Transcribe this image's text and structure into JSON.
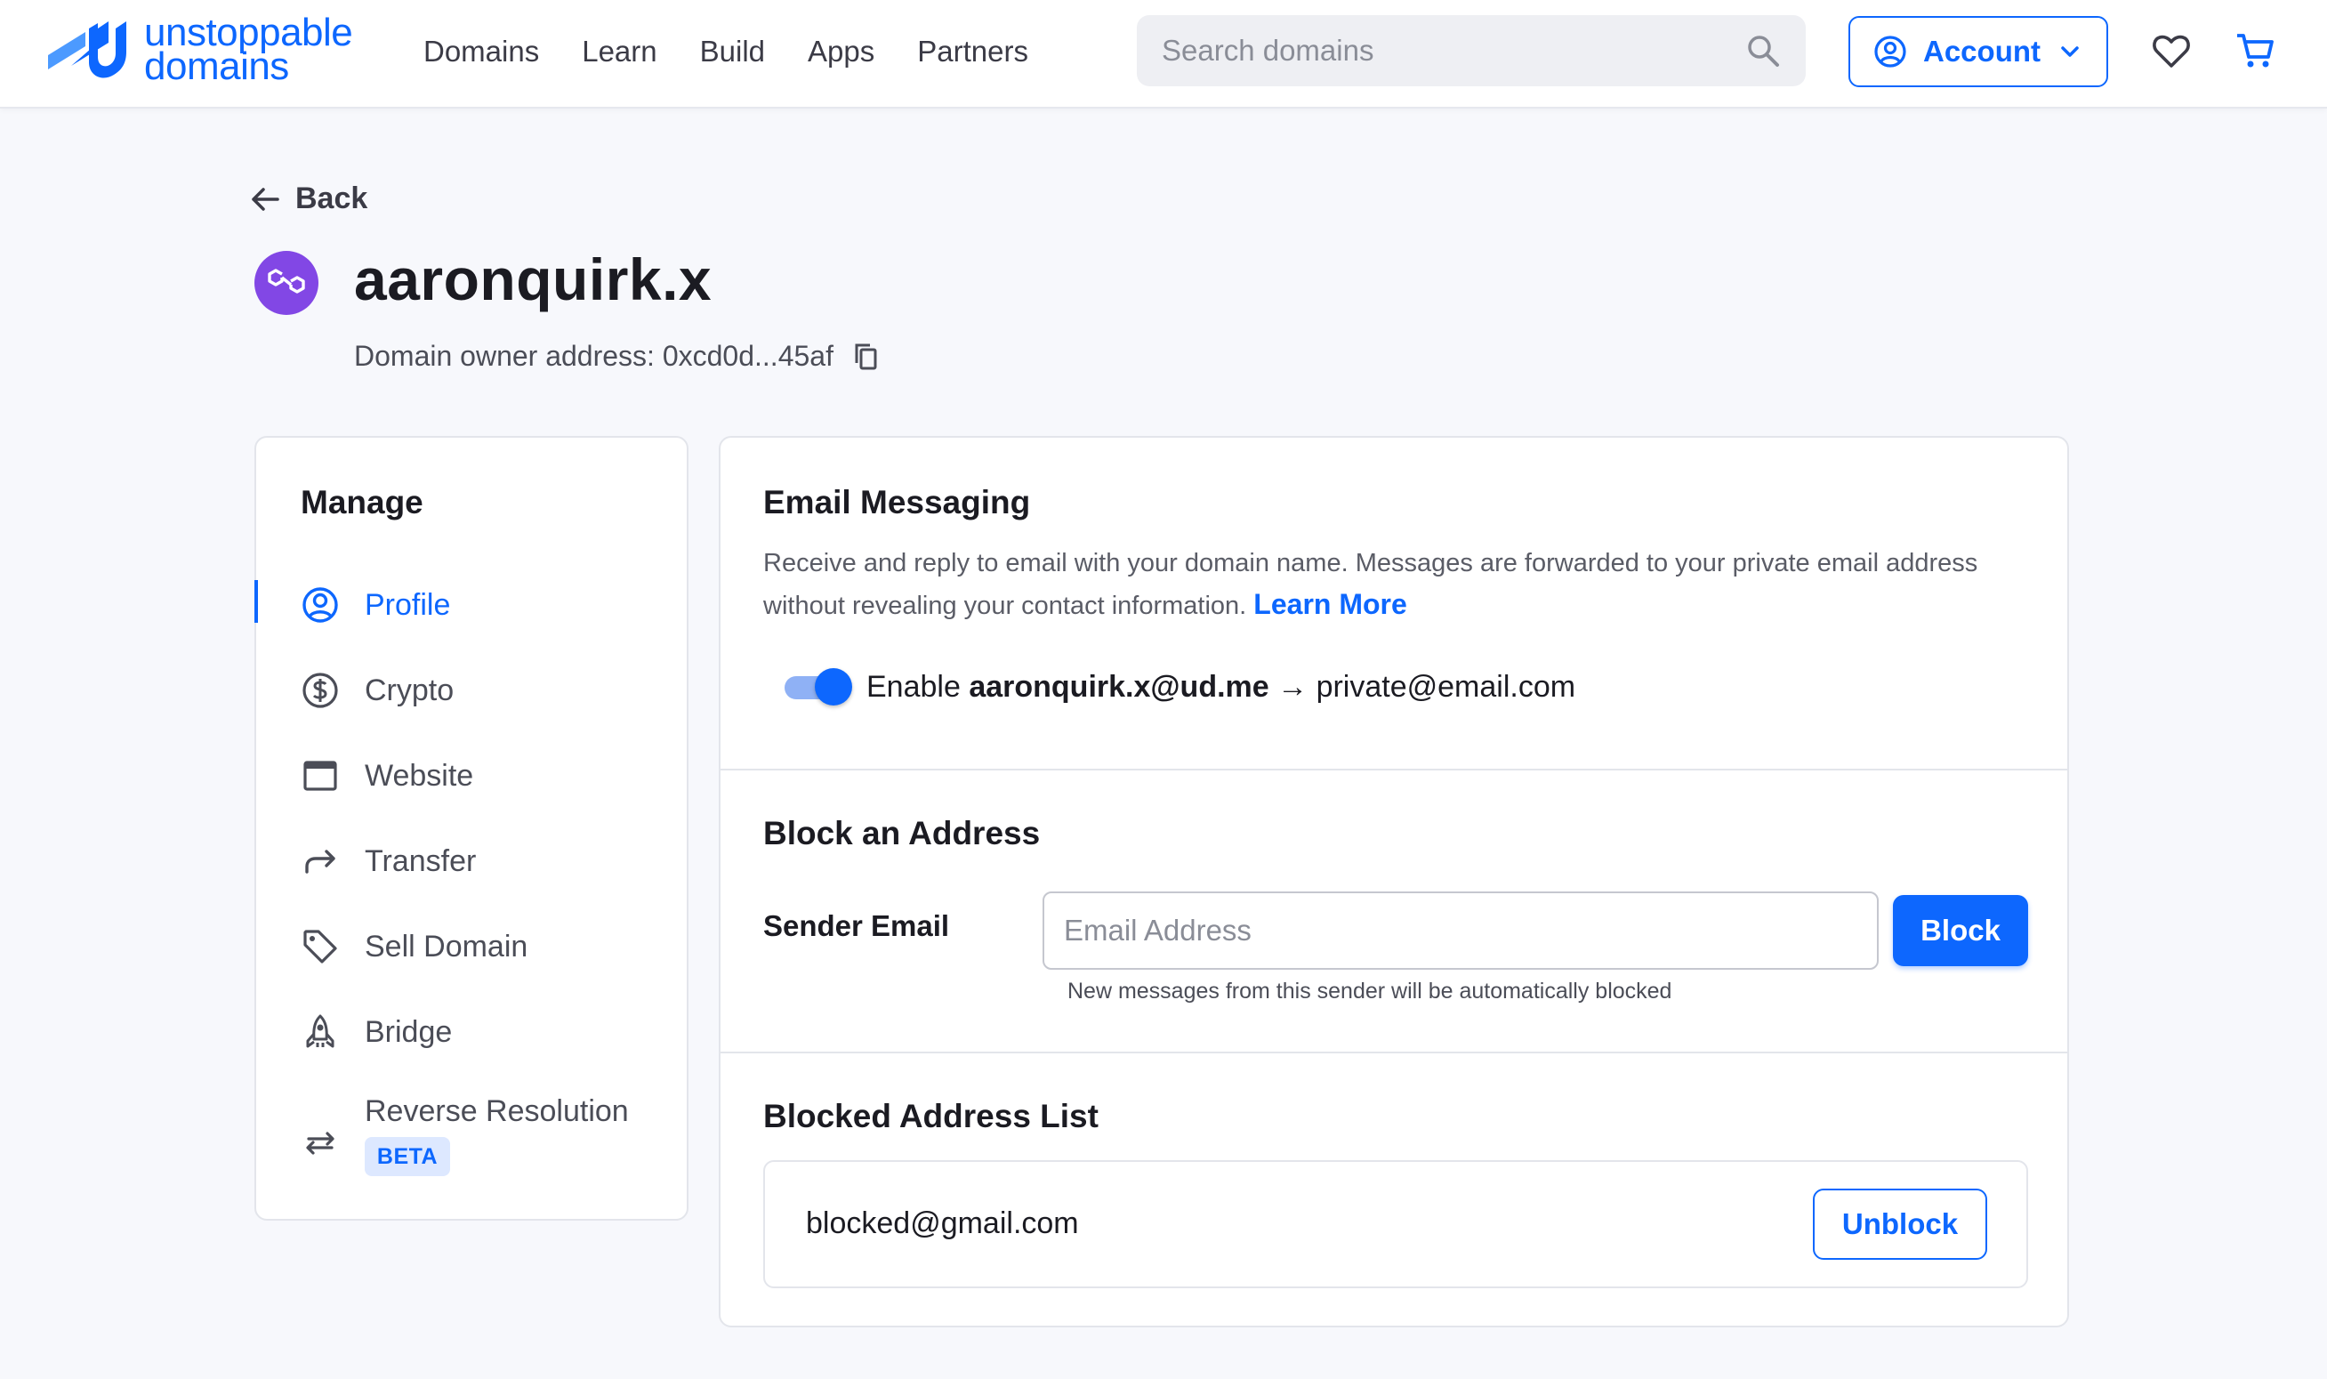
{
  "brand": {
    "line1": "unstoppable",
    "line2": "domains",
    "accent": "#0d67fe"
  },
  "nav": [
    "Domains",
    "Learn",
    "Build",
    "Apps",
    "Partners"
  ],
  "search": {
    "placeholder": "Search domains",
    "icon": "search-icon"
  },
  "account": {
    "label": "Account",
    "icon": "user-circle-icon"
  },
  "header_icons": [
    "heart-icon",
    "cart-icon"
  ],
  "back": {
    "label": "Back"
  },
  "domain": {
    "name": "aaronquirk.x",
    "owner_text": "Domain owner address: 0xcd0d...45af",
    "icon_color": "#8247e5"
  },
  "sidebar": {
    "title": "Manage",
    "items": [
      {
        "label": "Profile",
        "icon": "user-circle-icon",
        "active": true
      },
      {
        "label": "Crypto",
        "icon": "dollar-circle-icon"
      },
      {
        "label": "Website",
        "icon": "browser-window-icon"
      },
      {
        "label": "Transfer",
        "icon": "share-arrow-icon"
      },
      {
        "label": "Sell Domain",
        "icon": "tag-icon"
      },
      {
        "label": "Bridge",
        "icon": "rocket-icon"
      },
      {
        "label": "Reverse Resolution",
        "icon": "swap-arrows-icon",
        "badge": "BETA"
      }
    ]
  },
  "email_messaging": {
    "title": "Email Messaging",
    "description": "Receive and reply to email with your domain name. Messages are forwarded to your private email address without revealing your contact information.",
    "learn_more": "Learn More",
    "toggle_on": true,
    "enable_prefix": "Enable",
    "domain_email": "aaronquirk.x@ud.me",
    "arrow": "→",
    "private_email": "private@email.com"
  },
  "block": {
    "title": "Block an Address",
    "sender_label": "Sender Email",
    "placeholder": "Email Address",
    "button": "Block",
    "helper": "New messages from this sender will be automatically blocked"
  },
  "blocked_list": {
    "title": "Blocked Address List",
    "items": [
      {
        "email": "blocked@gmail.com",
        "action": "Unblock"
      }
    ]
  }
}
